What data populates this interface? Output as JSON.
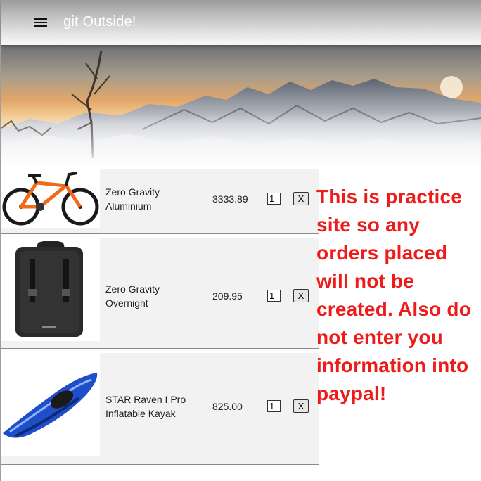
{
  "app": {
    "title": "git Outside!",
    "menu_icon": "hamburger-menu-icon"
  },
  "hero": {
    "description_icon": "mountain-banner-image"
  },
  "cart": {
    "items": [
      {
        "name": "Zero Gravity Aluminium",
        "price": "3333.89",
        "quantity": "1",
        "remove_label": "X",
        "image": "orange-bike-image"
      },
      {
        "name": "Zero Gravity Overnight",
        "price": "209.95",
        "quantity": "1",
        "remove_label": "X",
        "image": "black-backpack-image"
      },
      {
        "name": "STAR Raven I Pro Inflatable Kayak",
        "price": "825.00",
        "quantity": "1",
        "remove_label": "X",
        "image": "blue-kayak-image"
      }
    ]
  },
  "notice": {
    "text": "This is practice site so any orders placed will not be created. Also do not enter you information into paypal!"
  },
  "colors": {
    "notice_red": "#ee1b1b",
    "row_bg": "#f2f2f2",
    "appbar_gray": "#c4c4c4"
  }
}
